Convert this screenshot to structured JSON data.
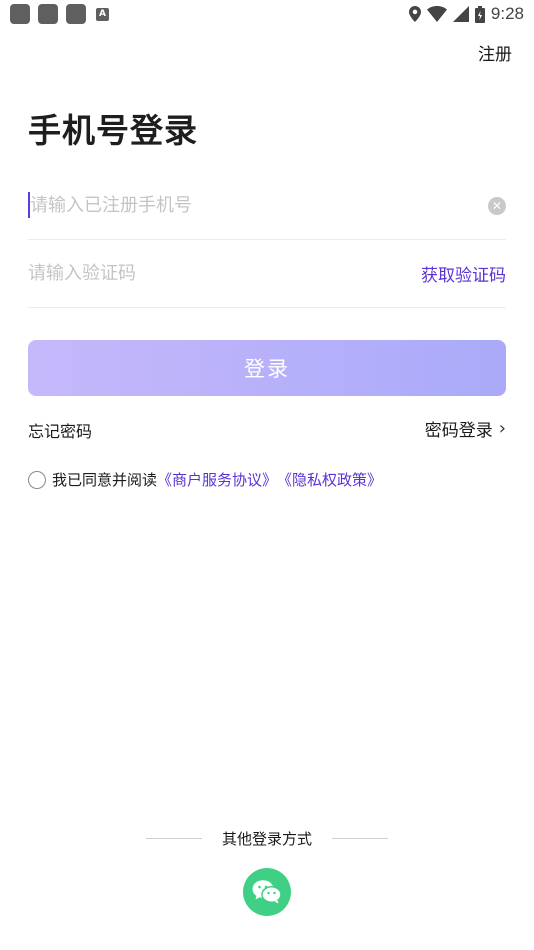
{
  "status_bar": {
    "time": "9:28",
    "a_icon_label": "A"
  },
  "header": {
    "register_label": "注册"
  },
  "main": {
    "title": "手机号登录",
    "phone_placeholder": "请输入已注册手机号",
    "code_placeholder": "请输入验证码",
    "get_code_label": "获取验证码",
    "login_label": "登录",
    "forgot_label": "忘记密码",
    "password_login_label": "密码登录",
    "chevron": "›"
  },
  "agreement": {
    "prefix": "我已同意并阅读",
    "service_link": "《商户服务协议》",
    "privacy_link": "《隐私权政策》"
  },
  "footer": {
    "other_methods_label": "其他登录方式",
    "wechat_icon": "wechat-icon"
  },
  "colors": {
    "accent": "#5a32d6",
    "button_start": "#c6b8fb",
    "button_end": "#a9aaf9",
    "wechat_green": "#3fcf85"
  }
}
